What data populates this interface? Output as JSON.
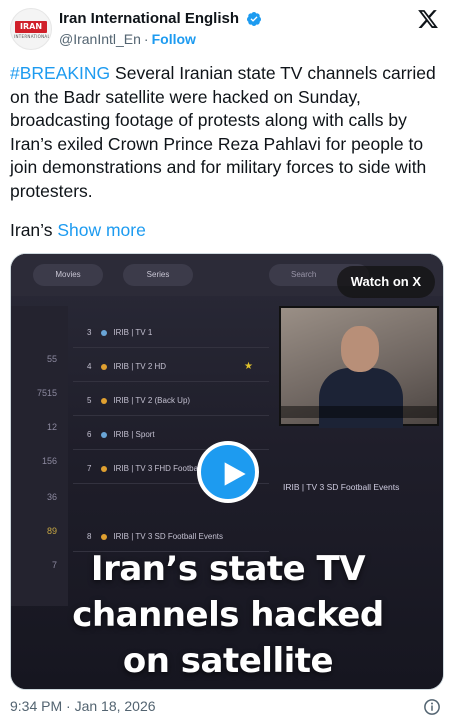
{
  "author": {
    "display_name": "Iran International English",
    "handle": "@IranIntl_En",
    "separator": "·",
    "follow_label": "Follow",
    "avatar_logo_text": "IRAN",
    "avatar_logo_sub": "INTERNATIONAL"
  },
  "tweet": {
    "hashtag": "#BREAKING",
    "body": " Several Iranian state TV channels carried on the Badr satellite were hacked on Sunday, broadcasting footage of protests along with calls by Iran’s exiled Crown Prince Reza Pahlavi for people to join demonstrations and for military forces to side with protesters.",
    "truncated_lead": "Iran’s ",
    "show_more_label": "Show more",
    "timestamp": "9:34 PM · Jan 18, 2026"
  },
  "media": {
    "watch_label": "Watch on X",
    "overlay_title_lines": [
      "Iran’s state TV",
      "channels hacked",
      "on satellite"
    ],
    "tabs": [
      "Movies",
      "Series"
    ],
    "search_placeholder": "Search",
    "numbers": [
      "55",
      "7515",
      "12",
      "156",
      "36",
      "89",
      "7"
    ],
    "channels": [
      {
        "num": "3",
        "name": "IRIB | TV 1"
      },
      {
        "num": "4",
        "name": "IRIB | TV 2 HD"
      },
      {
        "num": "5",
        "name": "IRIB | TV 2 (Back Up)"
      },
      {
        "num": "6",
        "name": "IRIB | Sport"
      },
      {
        "num": "7",
        "name": "IRIB | TV 3 FHD Football"
      },
      {
        "num": "8",
        "name": "IRIB | TV 3 SD Football Events"
      }
    ],
    "video_caption": "IRIB | TV 3 SD Football Events"
  },
  "colors": {
    "accent": "#1d9bf0",
    "text_primary": "#0f1419",
    "text_secondary": "#536471"
  }
}
